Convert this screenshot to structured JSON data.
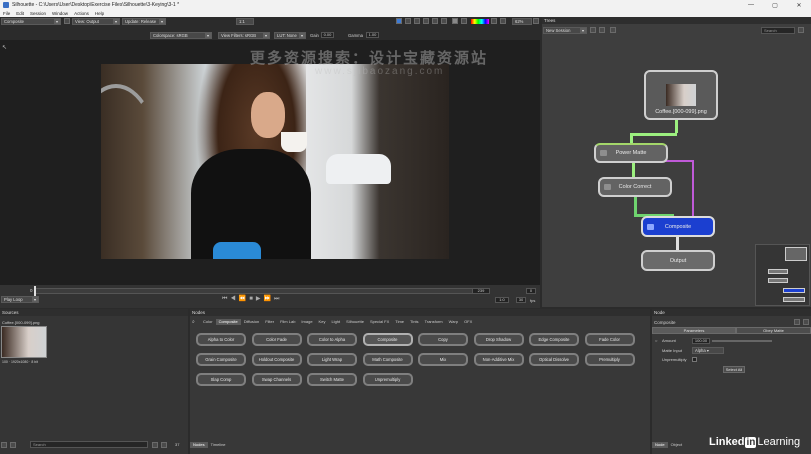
{
  "window": {
    "title": "Silhouette - C:\\Users\\User\\Desktop\\Exercise Files\\Silhouette\\3-Keying\\3-1 *",
    "min": "—",
    "max": "▢",
    "close": "✕"
  },
  "menu": [
    "File",
    "Edit",
    "Session",
    "Window",
    "Actions",
    "Help"
  ],
  "toolbar": {
    "mode": "Composite",
    "view": "View: Output",
    "update": "Update: Release",
    "colorspace": "Colorspace: sRGB",
    "viewfilter": "View Filters: sRGB",
    "channel": "LUT: None",
    "gain_label": "Gain",
    "gain": "0.00",
    "gamma_label": "Gamma",
    "gamma": "1.00",
    "zoom": "62%",
    "ratio": "1:1"
  },
  "watermark": {
    "line1": "更多资源搜索：设计宝藏资源站",
    "line2": "www.sjibaozang.com"
  },
  "timeline": {
    "start": "0",
    "current": "239",
    "end": "0",
    "fps_frame": "1:0",
    "fps": "30",
    "fps_label": "fps",
    "loop": "Play Loop"
  },
  "trees": {
    "title": "Trees",
    "session": "New Session",
    "search": "Search",
    "nodes": [
      {
        "name": "Coffee.[000-099].png"
      },
      {
        "name": "Power Matte"
      },
      {
        "name": "Color Correct"
      },
      {
        "name": "Composite"
      },
      {
        "name": "Output"
      }
    ]
  },
  "sources": {
    "title": "Sources",
    "file": "Coffee.[000-099].png",
    "meta": "100 · 1920x1080 · 8 bit",
    "search": "Search",
    "count": "37"
  },
  "nodes": {
    "title": "Nodes",
    "tabs": [
      "Color",
      "Composite",
      "Diffusion",
      "Filter",
      "Film Lab",
      "Image",
      "Key",
      "Light",
      "Silhouette",
      "Special FX",
      "Time",
      "Tints",
      "Transform",
      "Warp",
      "OFX"
    ],
    "active_tab": "Composite",
    "buttons": [
      "Alpha to Color",
      "Color Fade",
      "Color to Alpha",
      "Composite",
      "Copy",
      "Drop Shadow",
      "Edge Composite",
      "Fade Color",
      "Grain Composite",
      "Holdout Composite",
      "Light Wrap",
      "Math Composite",
      "Mix",
      "Non-Additive Mix",
      "Optical Dissolve",
      "Premultiply",
      "Slap Comp",
      "Swap Channels",
      "Switch Matte",
      "Unpremultiply"
    ],
    "bottom_tabs": [
      "Nodes",
      "Timeline"
    ]
  },
  "node_panel": {
    "title": "Node",
    "subtitle": "Composite",
    "tabs": [
      "Parameters",
      "Obey Matte"
    ],
    "amount_label": "Amount",
    "amount": "100.00",
    "matte_label": "Matte Input",
    "matte_value": "Alpha ▾",
    "unpremult_label": "Unpremultiply",
    "select_all": "Select All",
    "bottom_tabs": [
      "Node",
      "Object"
    ]
  },
  "brand": {
    "name_a": "Linked",
    "name_in": "in",
    "name_b": "Learning"
  }
}
